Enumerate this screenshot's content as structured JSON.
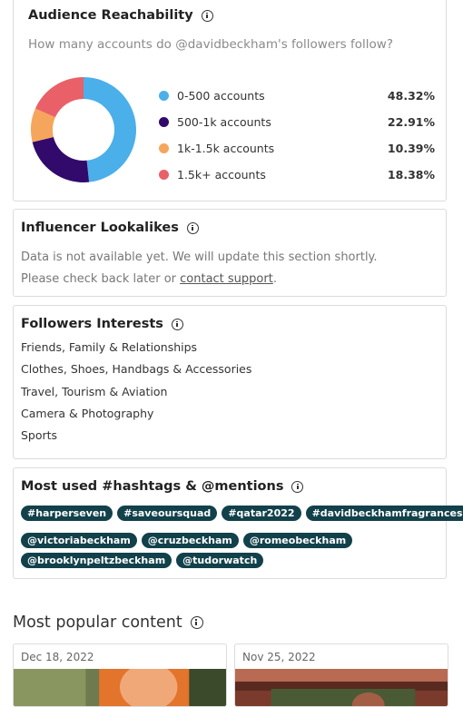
{
  "audience_reachability": {
    "title": "Audience Reachability",
    "question": "How many accounts do @davidbeckham's followers follow?",
    "chart_data": {
      "type": "pie",
      "variant": "donut",
      "categories": [
        "0-500 accounts",
        "500-1k accounts",
        "1k-1.5k accounts",
        "1.5k+ accounts"
      ],
      "values": [
        48.32,
        22.91,
        10.39,
        18.38
      ],
      "labels": [
        "48.32%",
        "22.91%",
        "10.39%",
        "18.38%"
      ],
      "colors": [
        "#4bafe9",
        "#320a6b",
        "#f6a65c",
        "#ea6068"
      ],
      "legend_position": "right"
    }
  },
  "influencer_lookalikes": {
    "title": "Influencer Lookalikes",
    "line1": "Data is not available yet. We will update this section shortly.",
    "line2_prefix": "Please check back later or ",
    "link": "contact support",
    "line2_suffix": "."
  },
  "followers_interests": {
    "title": "Followers Interests",
    "items": [
      "Friends, Family & Relationships",
      "Clothes, Shoes, Handbags & Accessories",
      "Travel, Tourism & Aviation",
      "Camera & Photography",
      "Sports"
    ]
  },
  "hashtags": {
    "title": "Most used #hashtags & @mentions",
    "row1": [
      "#harperseven",
      "#saveoursquad",
      "#qatar2022",
      "#davidbeckhamfragrances"
    ],
    "row2": [
      "@victoriabeckham",
      "@cruzbeckham",
      "@romeobeckham"
    ],
    "row3": [
      "@brooklynpeltzbeckham",
      "@tudorwatch"
    ]
  },
  "popular_content": {
    "title": "Most popular content",
    "posts": [
      {
        "date": "Dec 18, 2022"
      },
      {
        "date": "Nov 25, 2022"
      }
    ]
  }
}
